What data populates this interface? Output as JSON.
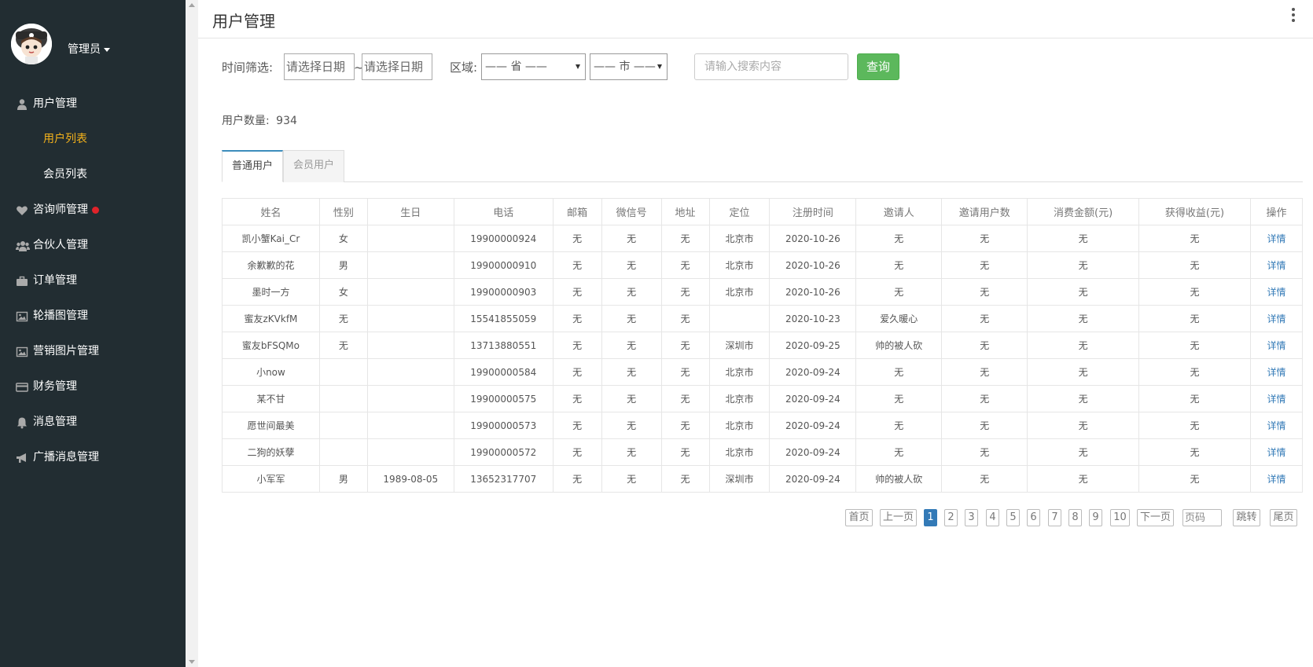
{
  "sidebar": {
    "admin_name": "管理员",
    "menu": [
      {
        "label": "用户管理",
        "icon": "user-icon"
      },
      {
        "label": "咨询师管理",
        "icon": "heart-icon"
      },
      {
        "label": "合伙人管理",
        "icon": "users-icon"
      },
      {
        "label": "订单管理",
        "icon": "briefcase-icon"
      },
      {
        "label": "轮播图管理",
        "icon": "image-icon"
      },
      {
        "label": "营销图片管理",
        "icon": "image-icon"
      },
      {
        "label": "财务管理",
        "icon": "credit-card-icon"
      },
      {
        "label": "消息管理",
        "icon": "bell-icon"
      },
      {
        "label": "广播消息管理",
        "icon": "bullhorn-icon"
      }
    ],
    "submenu": [
      {
        "label": "用户列表",
        "active": true
      },
      {
        "label": "会员列表",
        "active": false
      }
    ],
    "active_color": "#f4b21b",
    "badge_color": "#e0232a"
  },
  "header": {
    "title": "用户管理"
  },
  "filter": {
    "time_label": "时间筛选:",
    "date_start_placeholder": "请选择日期",
    "range_sep": "~",
    "date_end_placeholder": "请选择日期",
    "region_label": "区域:",
    "province": "—— 省 ——",
    "city": "—— 市 ——",
    "search_placeholder": "请输入搜索内容",
    "query_button": "查询"
  },
  "stats": {
    "user_count_label": "用户数量:",
    "user_count": "934"
  },
  "tabs": [
    "普通用户",
    "会员用户"
  ],
  "table": {
    "columns": [
      "姓名",
      "性别",
      "生日",
      "电话",
      "邮箱",
      "微信号",
      "地址",
      "定位",
      "注册时间",
      "邀请人",
      "邀请用户数",
      "消费金额(元)",
      "获得收益(元)",
      "操作"
    ],
    "rows": [
      [
        "凯小蟹Kai_Cr",
        "女",
        "",
        "19900000924",
        "无",
        "无",
        "无",
        "北京市",
        "2020-10-26",
        "无",
        "无",
        "无",
        "无",
        "详情"
      ],
      [
        "余歉歉的花",
        "男",
        "",
        "19900000910",
        "无",
        "无",
        "无",
        "北京市",
        "2020-10-26",
        "无",
        "无",
        "无",
        "无",
        "详情"
      ],
      [
        "墨时一方",
        "女",
        "",
        "19900000903",
        "无",
        "无",
        "无",
        "北京市",
        "2020-10-26",
        "无",
        "无",
        "无",
        "无",
        "详情"
      ],
      [
        "蜜友zKVkfM",
        "无",
        "",
        "15541855059",
        "无",
        "无",
        "无",
        "",
        "2020-10-23",
        "爱久暖心",
        "无",
        "无",
        "无",
        "详情"
      ],
      [
        "蜜友bFSQMo",
        "无",
        "",
        "13713880551",
        "无",
        "无",
        "无",
        "深圳市",
        "2020-09-25",
        "帅的被人砍",
        "无",
        "无",
        "无",
        "详情"
      ],
      [
        "小now",
        "",
        "",
        "19900000584",
        "无",
        "无",
        "无",
        "北京市",
        "2020-09-24",
        "无",
        "无",
        "无",
        "无",
        "详情"
      ],
      [
        "某不甘",
        "",
        "",
        "19900000575",
        "无",
        "无",
        "无",
        "北京市",
        "2020-09-24",
        "无",
        "无",
        "无",
        "无",
        "详情"
      ],
      [
        "愿世间最美",
        "",
        "",
        "19900000573",
        "无",
        "无",
        "无",
        "北京市",
        "2020-09-24",
        "无",
        "无",
        "无",
        "无",
        "详情"
      ],
      [
        "二狗的妖孽",
        "",
        "",
        "19900000572",
        "无",
        "无",
        "无",
        "北京市",
        "2020-09-24",
        "无",
        "无",
        "无",
        "无",
        "详情"
      ],
      [
        "小军军",
        "男",
        "1989-08-05",
        "13652317707",
        "无",
        "无",
        "无",
        "深圳市",
        "2020-09-24",
        "帅的被人砍",
        "无",
        "无",
        "无",
        "详情"
      ]
    ]
  },
  "pagination": {
    "first": "首页",
    "prev": "上一页",
    "pages": [
      "1",
      "2",
      "3",
      "4",
      "5",
      "6",
      "7",
      "8",
      "9",
      "10"
    ],
    "current": "1",
    "next": "下一页",
    "page_input_placeholder": "页码",
    "jump": "跳转",
    "last": "尾页"
  }
}
